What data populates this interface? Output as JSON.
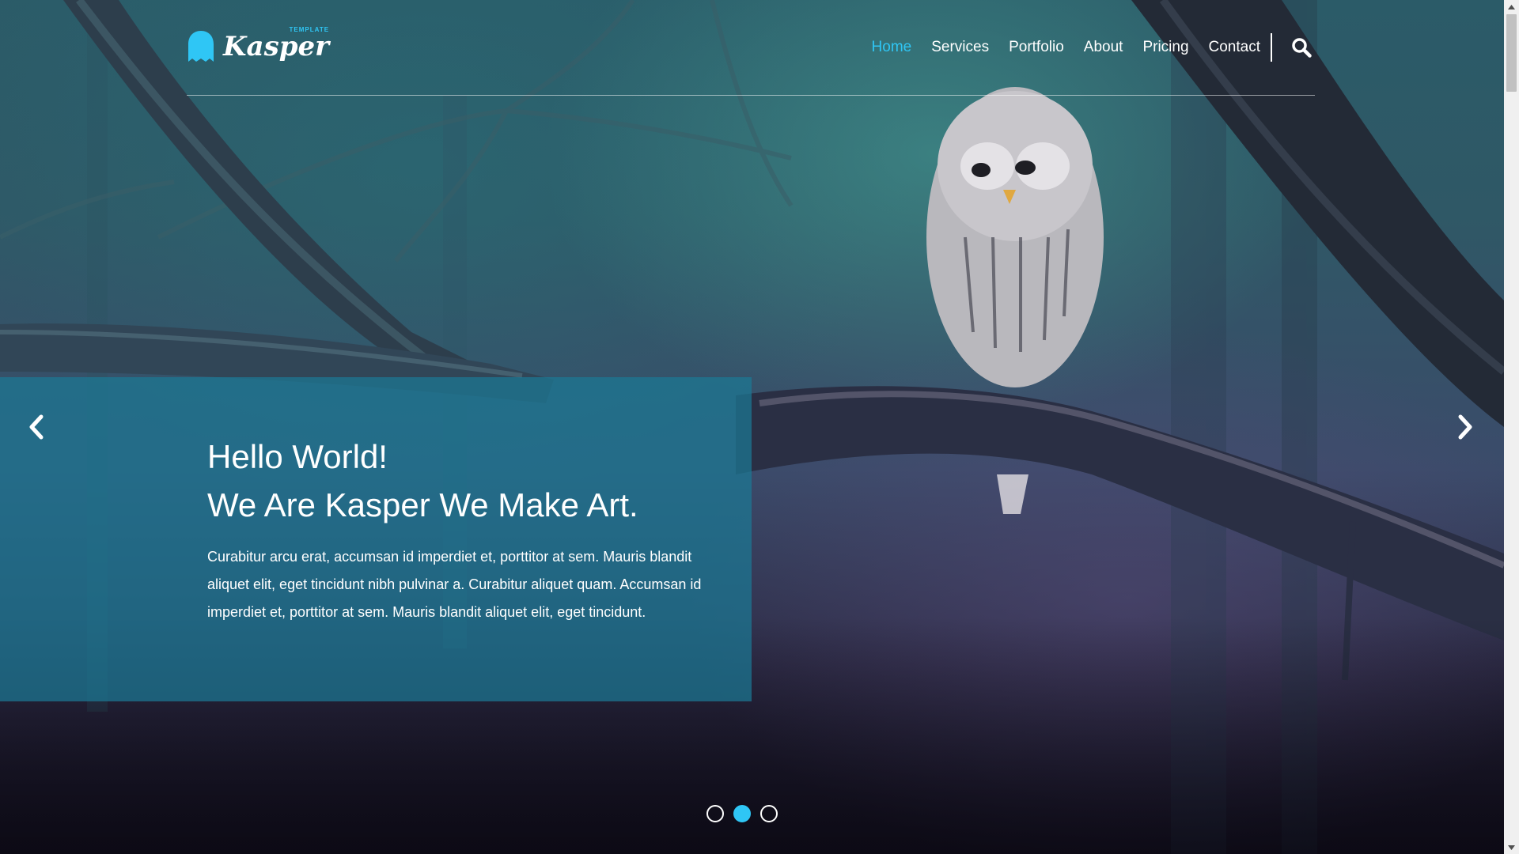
{
  "brand": {
    "name": "Kasper",
    "tag": "TEMPLATE",
    "accent": "#2fc6f5"
  },
  "nav": {
    "items": [
      {
        "label": "Home",
        "active": true
      },
      {
        "label": "Services",
        "active": false
      },
      {
        "label": "Portfolio",
        "active": false
      },
      {
        "label": "About",
        "active": false
      },
      {
        "label": "Pricing",
        "active": false
      },
      {
        "label": "Contact",
        "active": false
      }
    ],
    "search_icon": "search-icon"
  },
  "hero": {
    "title_line1": "Hello World!",
    "title_line2": "We Are Kasper We Make Art.",
    "text": "Curabitur arcu erat, accumsan id imperdiet et, porttitor at sem. Mauris blandit aliquet elit, eget tincidunt nibh pulvinar a. Curabitur aliquet quam. Accumsan id imperdiet et, porttitor at sem. Mauris blandit aliquet elit, eget tincidunt.",
    "caption_color": "#1c7894"
  },
  "slider": {
    "prev_icon": "chevron-left-icon",
    "next_icon": "chevron-right-icon",
    "dot_count": 3,
    "active_dot": 2
  }
}
